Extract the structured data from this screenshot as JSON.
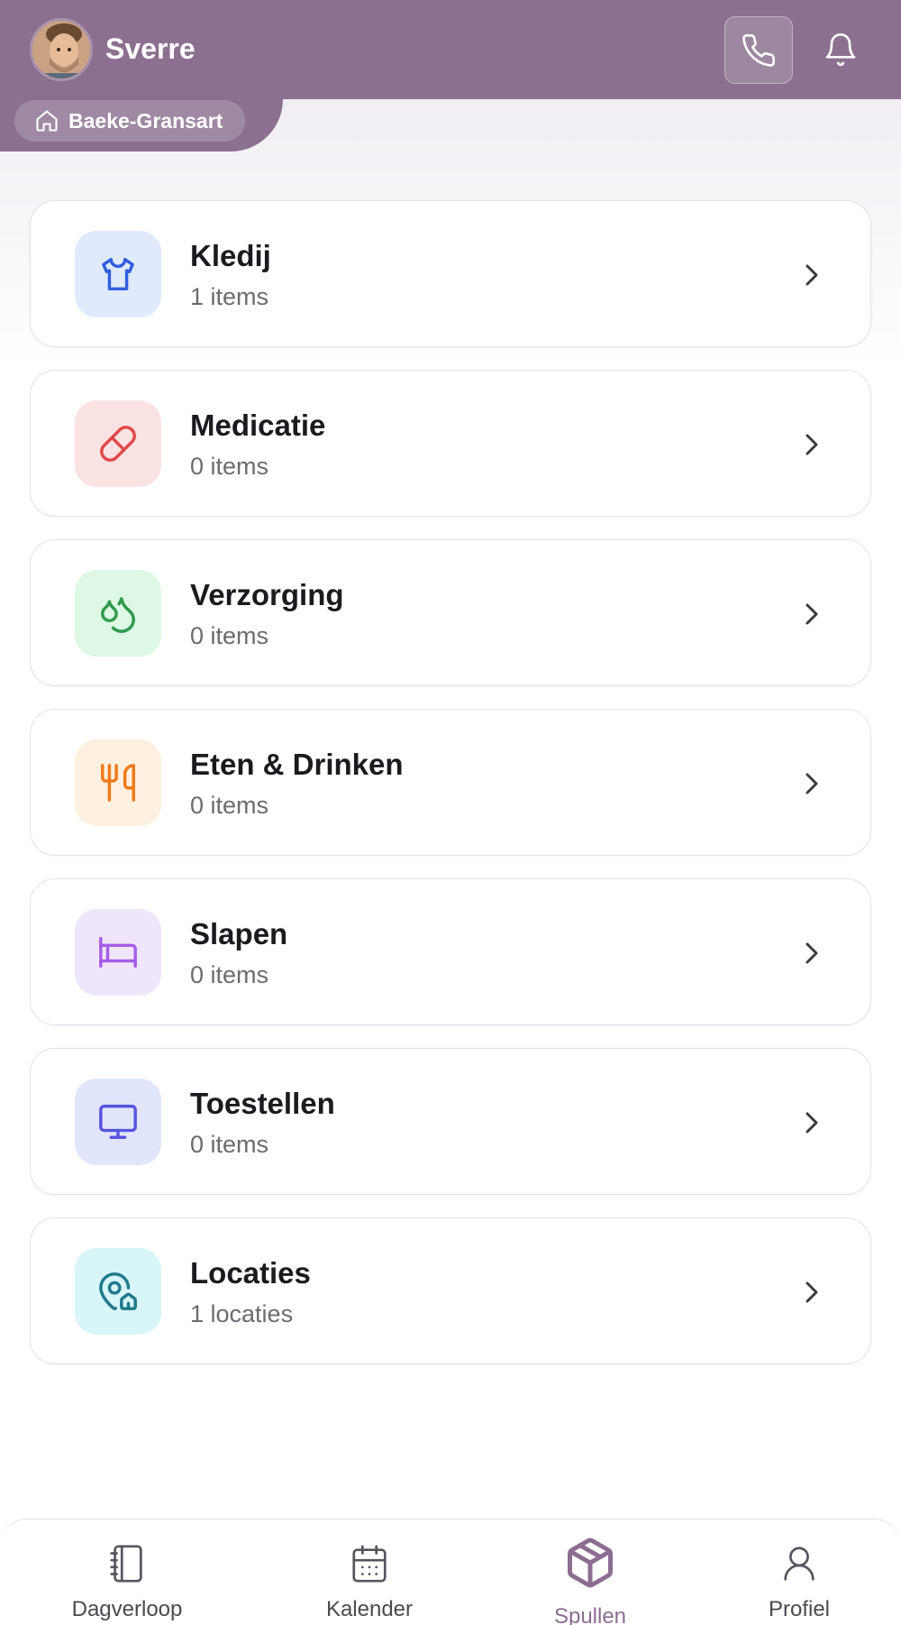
{
  "header": {
    "user_name": "Sverre",
    "household": "Baeke-Gransart",
    "actions": [
      "phone-icon",
      "bell-icon"
    ],
    "header_color": "#8c7090"
  },
  "categories": [
    {
      "title": "Kledij",
      "subtitle": "1 items",
      "icon": "shirt-icon",
      "icon_bg": "#e0eafd",
      "icon_color": "#2f5fe0"
    },
    {
      "title": "Medicatie",
      "subtitle": "0 items",
      "icon": "pill-icon",
      "icon_bg": "#fbe3e3",
      "icon_color": "#e04848"
    },
    {
      "title": "Verzorging",
      "subtitle": "0 items",
      "icon": "droplets-icon",
      "icon_bg": "#def8e6",
      "icon_color": "#2f9a4c"
    },
    {
      "title": "Eten & Drinken",
      "subtitle": "0 items",
      "icon": "utensils-icon",
      "icon_bg": "#fff0df",
      "icon_color": "#f07a18"
    },
    {
      "title": "Slapen",
      "subtitle": "0 items",
      "icon": "bed-icon",
      "icon_bg": "#f0e6fb",
      "icon_color": "#a55de8"
    },
    {
      "title": "Toestellen",
      "subtitle": "0 items",
      "icon": "monitor-icon",
      "icon_bg": "#e2e6fc",
      "icon_color": "#5755e0"
    },
    {
      "title": "Locaties",
      "subtitle": "1 locaties",
      "icon": "map-pin-house-icon",
      "icon_bg": "#d8f5fa",
      "icon_color": "#1e7a8c"
    }
  ],
  "nav": {
    "items": [
      {
        "label": "Dagverloop",
        "icon": "notebook-icon"
      },
      {
        "label": "Kalender",
        "icon": "calendar-icon"
      },
      {
        "label": "Spullen",
        "icon": "package-icon",
        "active": true
      },
      {
        "label": "Profiel",
        "icon": "user-icon"
      }
    ],
    "active_color": "#8c6d92"
  }
}
